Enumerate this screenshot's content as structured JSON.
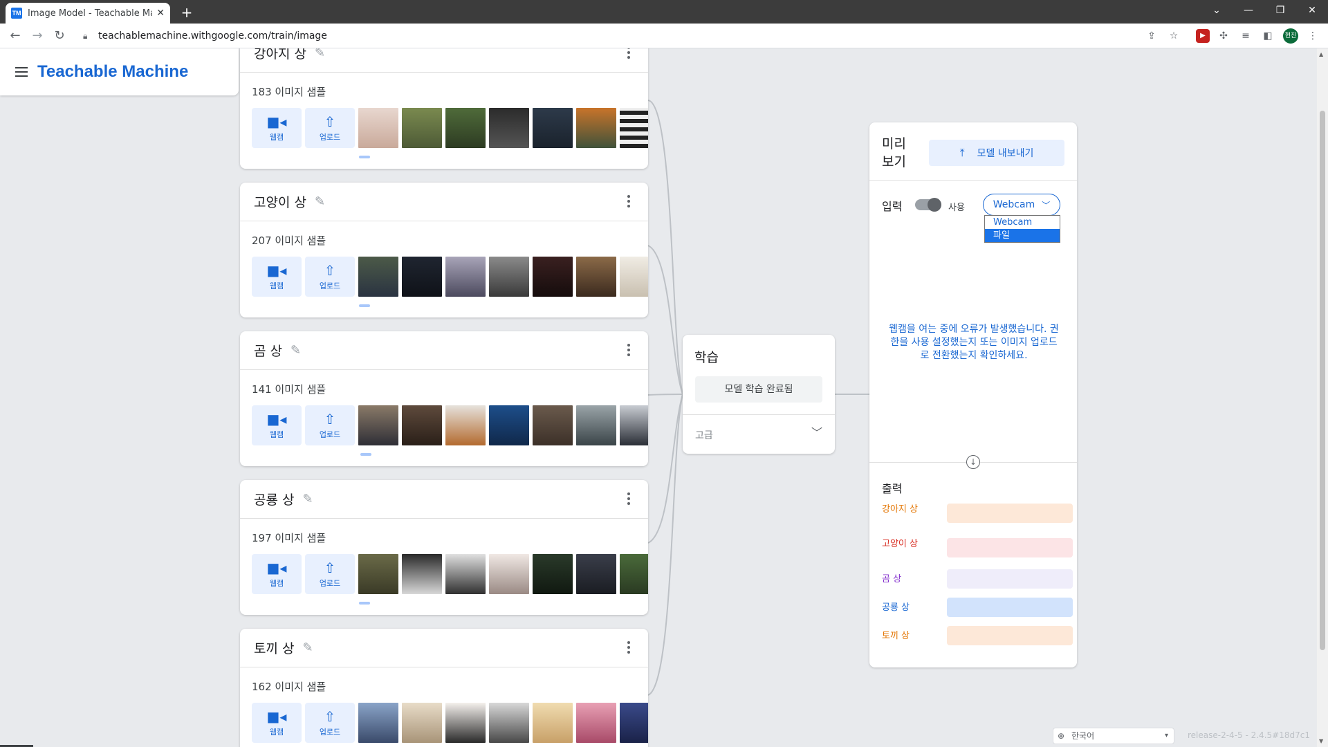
{
  "browser": {
    "tab_title": "Image Model - Teachable Mach",
    "tab_favicon": "TM",
    "url": "teachablemachine.withgoogle.com/train/image",
    "profile_initials": "현진"
  },
  "app": {
    "logo": "Teachable Machine"
  },
  "classes": [
    {
      "name": "강아지 상",
      "count": "183",
      "count_suffix": " 이미지 샘플"
    },
    {
      "name": "고양이 상",
      "count": "207",
      "count_suffix": " 이미지 샘플"
    },
    {
      "name": "곰 상",
      "count": "141",
      "count_suffix": " 이미지 샘플"
    },
    {
      "name": "공룡 상",
      "count": "197",
      "count_suffix": " 이미지 샘플"
    },
    {
      "name": "토끼 상",
      "count": "162",
      "count_suffix": " 이미지 샘플"
    }
  ],
  "sample_buttons": {
    "webcam": "웹캠",
    "upload": "업로드"
  },
  "training": {
    "title": "학습",
    "button": "모델 학습 완료됨",
    "advanced": "고급"
  },
  "preview": {
    "title": "미리 보기",
    "export_button": "모델 내보내기",
    "input_label": "입력",
    "toggle_label": "사용",
    "toggle_on": true,
    "select_value": "Webcam",
    "options": [
      "Webcam",
      "파일"
    ],
    "highlighted_option": "파일",
    "error_message": "웹캠을 여는 중에 오류가 발생했습니다. 권한을 사용 설정했는지 또는 이미지 업로드로 전환했는지 확인하세요.",
    "output_label": "출력",
    "outputs": [
      {
        "label": "강아지 상",
        "text_color": "#e37400",
        "bar_color": "#fde8d8"
      },
      {
        "label": "고양이 상",
        "text_color": "#d93025",
        "bar_color": "#fce4e6"
      },
      {
        "label": "곰 상",
        "text_color": "#8430ce",
        "bar_color": "#efedfa"
      },
      {
        "label": "공룡 상",
        "text_color": "#1967d2",
        "bar_color": "#d2e3fc"
      },
      {
        "label": "토끼 상",
        "text_color": "#e37400",
        "bar_color": "#fde8d8"
      }
    ]
  },
  "footer": {
    "language": "한국어",
    "release": "release-2-4-5 - 2.4.5#18d7c1"
  },
  "colors": {
    "accent": "#1967d2",
    "accent_light": "#e8f0fe"
  }
}
